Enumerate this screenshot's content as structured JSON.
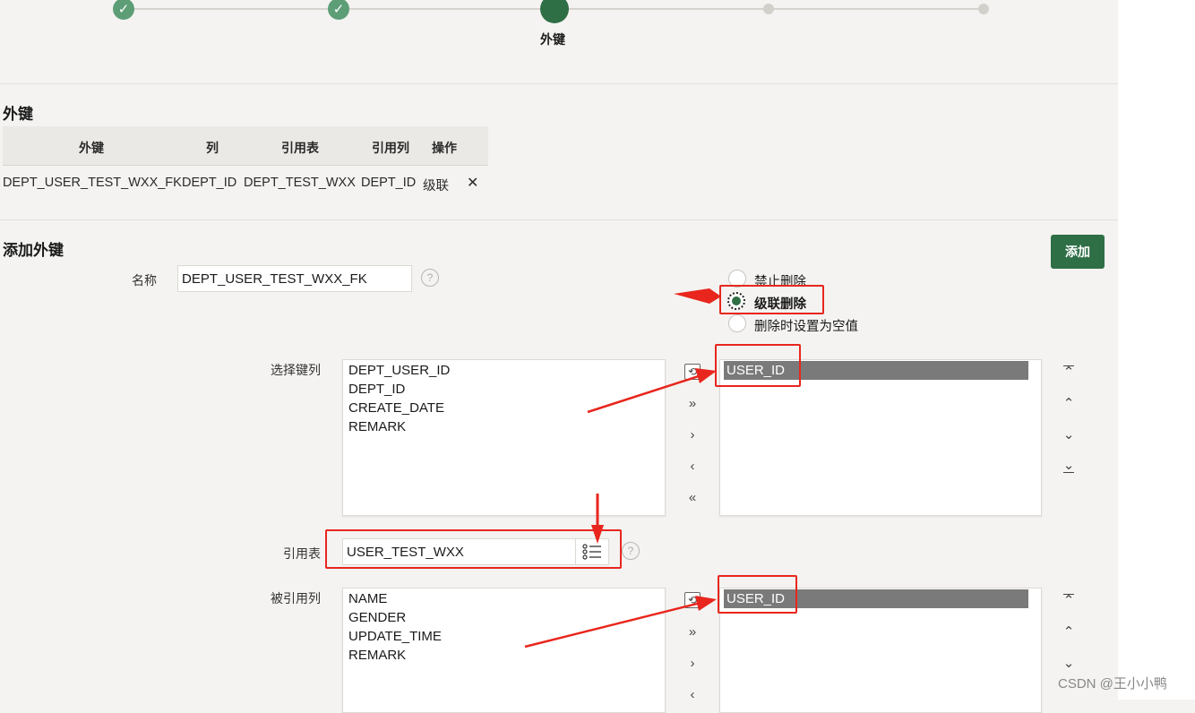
{
  "wizard": {
    "current_step_label": "外键",
    "check_glyph": "✓"
  },
  "fk_section": {
    "title": "外键",
    "columns": [
      "外键",
      "列",
      "引用表",
      "引用列",
      "操作"
    ],
    "rows": [
      {
        "name": "DEPT_USER_TEST_WXX_FK",
        "column": "DEPT_ID",
        "ref_table": "DEPT_TEST_WXX",
        "ref_column": "DEPT_ID",
        "action": "级联",
        "delete_icon": "close-icon"
      }
    ],
    "delete_glyph": "✕"
  },
  "add_section": {
    "title": "添加外键",
    "add_button": "添加",
    "name_label": "名称",
    "name_value": "DEPT_USER_TEST_WXX_FK",
    "help_glyph": "?",
    "delete_rule_options": [
      {
        "label": "禁止删除",
        "selected": false
      },
      {
        "label": "级联删除",
        "selected": true
      },
      {
        "label": "删除时设置为空值",
        "selected": false
      }
    ],
    "key_columns": {
      "label": "选择键列",
      "available": [
        "DEPT_USER_ID",
        "DEPT_ID",
        "CREATE_DATE",
        "REMARK"
      ],
      "selected": [
        "USER_ID"
      ]
    },
    "ref_table": {
      "label": "引用表",
      "value": "USER_TEST_WXX",
      "lov_icon": "list-icon"
    },
    "ref_columns": {
      "label": "被引用列",
      "available": [
        "NAME",
        "GENDER",
        "UPDATE_TIME",
        "REMARK"
      ],
      "selected": [
        "USER_ID"
      ]
    },
    "shuttle_glyphs": {
      "reset": "⟲",
      "move_all": "»",
      "move": "›",
      "remove": "‹",
      "remove_all": "«",
      "top": "⌃",
      "up": "⌃",
      "down": "⌄",
      "bottom": "⌄"
    }
  },
  "watermark": "CSDN @王小小鸭",
  "colors": {
    "accent": "#2f6f46",
    "step_done": "#5d9e77",
    "annotation": "#e8261d",
    "selected_row": "#7a7a7a"
  }
}
